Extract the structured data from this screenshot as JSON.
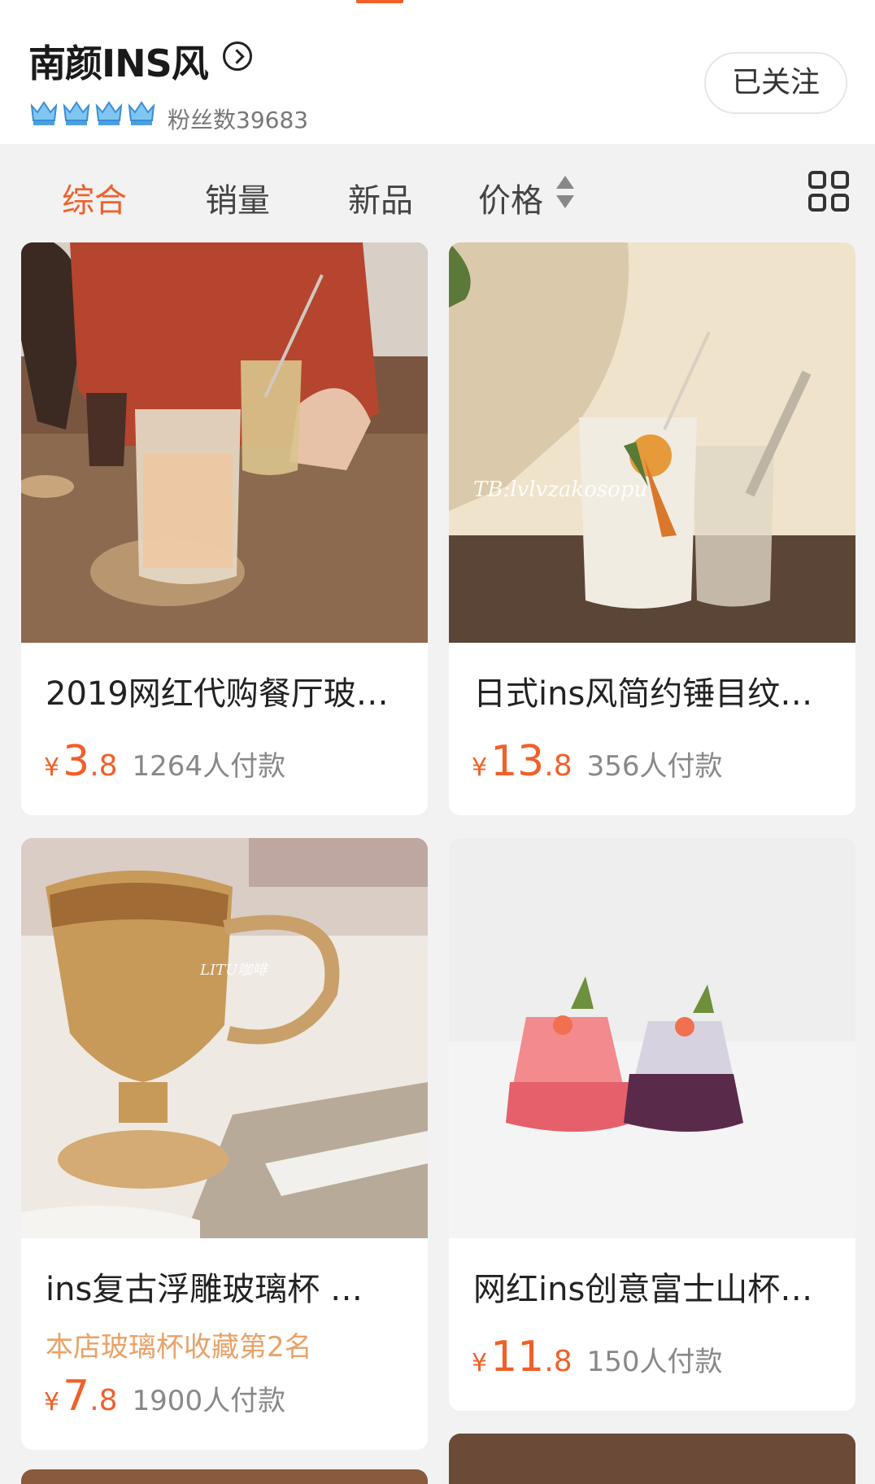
{
  "shop": {
    "name": "南颜INS风",
    "fans_label": "粉丝数39683",
    "follow_label": "已关注",
    "crown_count": 4
  },
  "sort_tabs": [
    {
      "label": "综合",
      "active": true
    },
    {
      "label": "销量",
      "active": false
    },
    {
      "label": "新品",
      "active": false
    },
    {
      "label": "价格",
      "active": false
    }
  ],
  "products": [
    {
      "title": "2019网红代购餐厅玻…",
      "currency": "¥",
      "price_int": "3",
      "price_dec": ".8",
      "sold": "1264人付款",
      "rank": ""
    },
    {
      "title": "日式ins风简约锤目纹…",
      "currency": "¥",
      "price_int": "13",
      "price_dec": ".8",
      "sold": "356人付款",
      "rank": "",
      "watermark": "TB:lvlvzakosopu"
    },
    {
      "title": "ins复古浮雕玻璃杯 …",
      "currency": "¥",
      "price_int": "7",
      "price_dec": ".8",
      "sold": "1900人付款",
      "rank": "本店玻璃杯收藏第2名",
      "watermark": "LITU咖啡"
    },
    {
      "title": "网红ins创意富士山杯…",
      "currency": "¥",
      "price_int": "11",
      "price_dec": ".8",
      "sold": "150人付款",
      "rank": ""
    }
  ],
  "colors": {
    "accent": "#f0602a",
    "rank": "#e8a268",
    "muted": "#888888"
  }
}
